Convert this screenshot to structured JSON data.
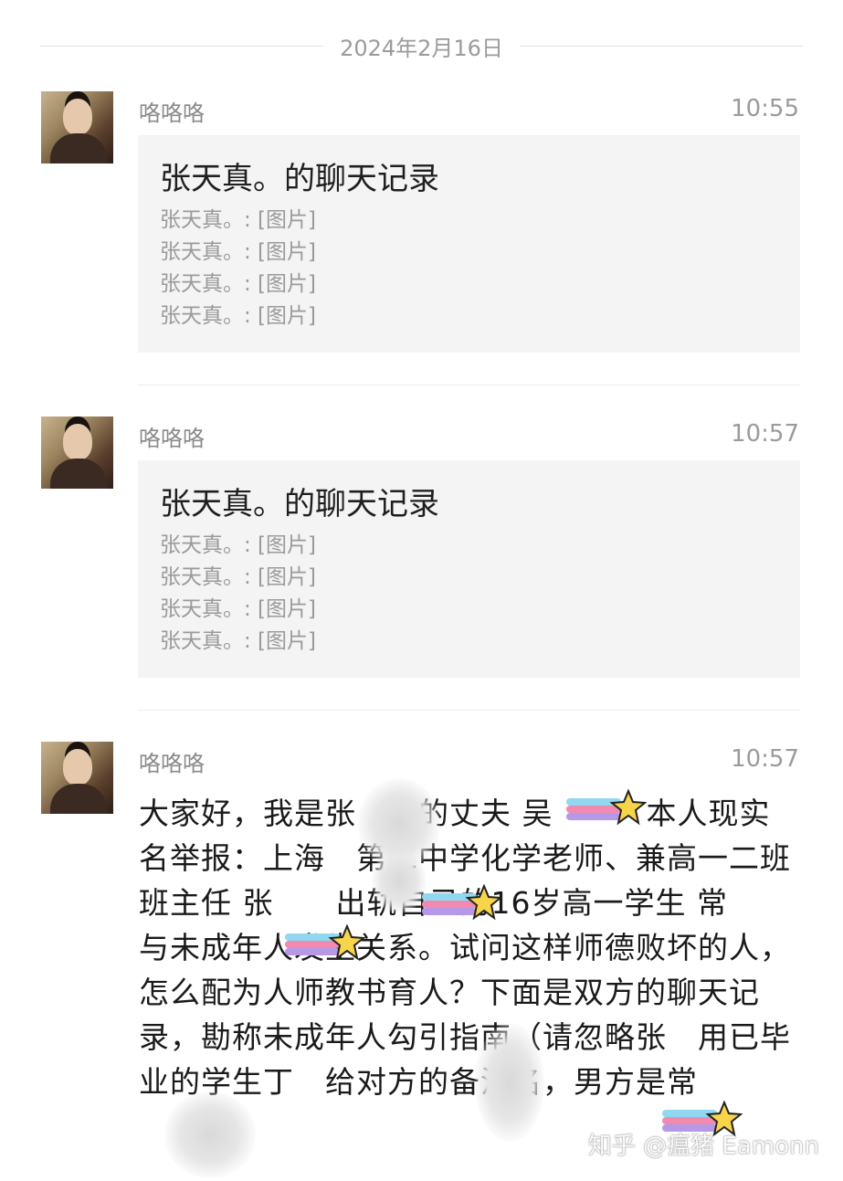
{
  "date_separator": "2024年2月16日",
  "messages": [
    {
      "sender": "咯咯咯",
      "time": "10:55",
      "card_title": "张天真。的聊天记录",
      "card_lines": [
        "张天真。: [图片]",
        "张天真。: [图片]",
        "张天真。: [图片]",
        "张天真。: [图片]"
      ]
    },
    {
      "sender": "咯咯咯",
      "time": "10:57",
      "card_title": "张天真。的聊天记录",
      "card_lines": [
        "张天真。: [图片]",
        "张天真。: [图片]",
        "张天真。: [图片]",
        "张天真。: [图片]"
      ]
    },
    {
      "sender": "咯咯咯",
      "time": "10:57",
      "text": "大家好，我是张　　的丈夫 吴　　　本人现实名举报：上海　第二中学化学老师、兼高一二班班主任 张　　出轨自己的16岁高一学生 常　　与未成年人发生关系。试问这样师德败坏的人，怎么配为人师教书育人？下面是双方的聊天记录，勘称未成年人勾引指南（请忽略张　用已毕业的学生丁　给对方的备注名，男方是常"
    }
  ],
  "watermark": "知乎 @瘟猪 Eamonn",
  "icons": [
    "avatar",
    "rainbow-star-sticker",
    "blur-patch"
  ]
}
